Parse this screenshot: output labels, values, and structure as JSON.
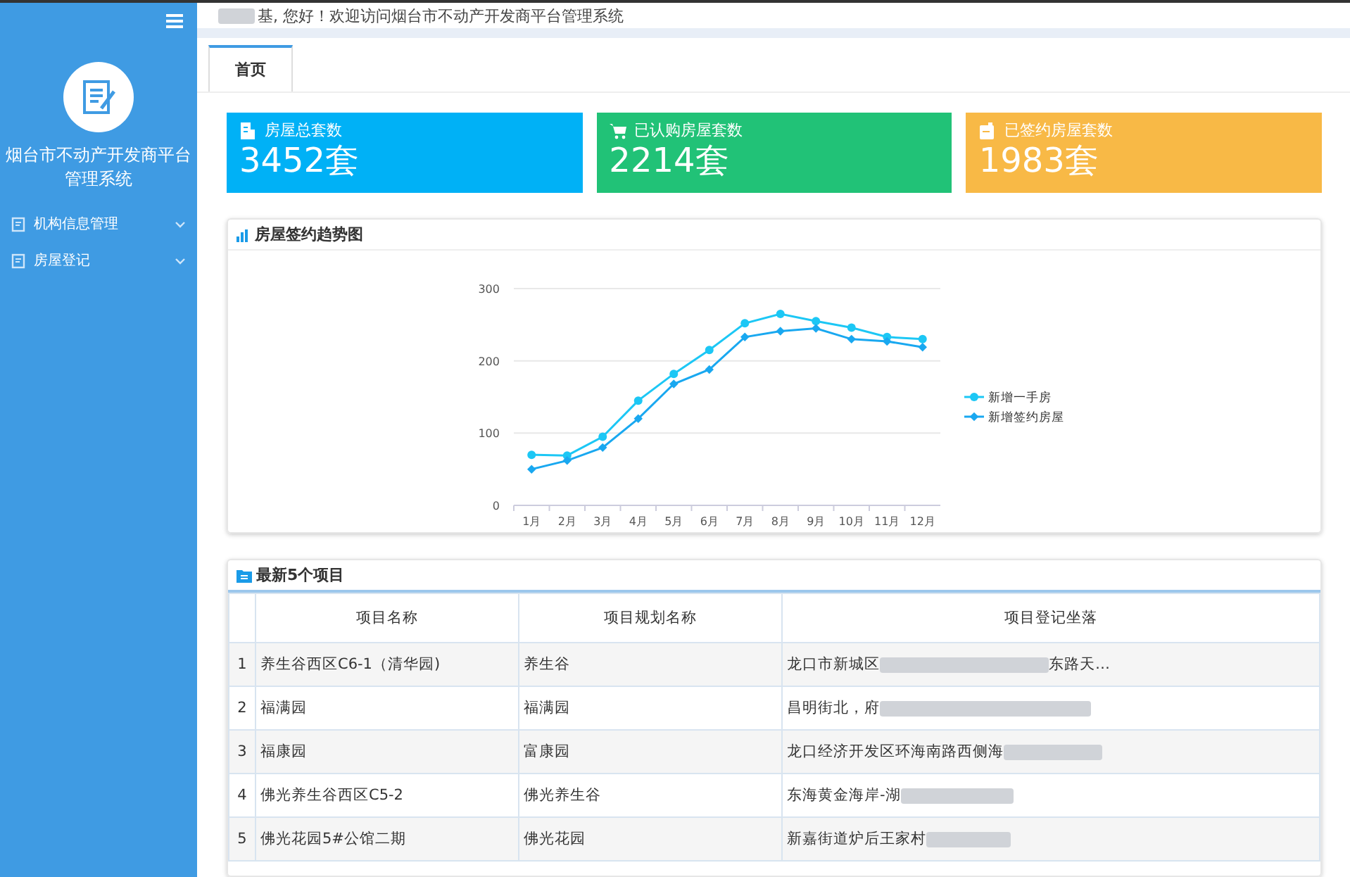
{
  "sidebar": {
    "title": "烟台市不动产开发商平台管理系统",
    "menu": [
      {
        "label": "机构信息管理",
        "expanded": false
      },
      {
        "label": "房屋登记",
        "expanded": false
      }
    ]
  },
  "header": {
    "greeting": "基, 您好！欢迎访问烟台市不动产开发商平台管理系统"
  },
  "tabs": [
    {
      "label": "首页",
      "selected": true
    }
  ],
  "stats": [
    {
      "kind": "building",
      "label": "房屋总套数",
      "value": "3452套",
      "color": "#00b1f6"
    },
    {
      "kind": "cart",
      "label": "已认购房屋套数",
      "value": "2214套",
      "color": "#21c277"
    },
    {
      "kind": "doc",
      "label": "已签约房屋套数",
      "value": "1983套",
      "color": "#f8b946"
    }
  ],
  "trend": {
    "title": "房屋签约趋势图",
    "chart_data": {
      "type": "line",
      "categories": [
        "1月",
        "2月",
        "3月",
        "4月",
        "5月",
        "6月",
        "7月",
        "8月",
        "9月",
        "10月",
        "11月",
        "12月"
      ],
      "ylim": [
        0,
        300
      ],
      "legend": "right",
      "yticks": [
        0,
        100,
        200,
        300
      ],
      "series": [
        {
          "name": "新增一手房",
          "color": "#1cc7f5",
          "marker": "circle",
          "values": [
            70,
            69,
            95,
            145,
            182,
            215,
            252,
            265,
            255,
            246,
            233,
            230
          ]
        },
        {
          "name": "新增签约房屋",
          "color": "#19a8f0",
          "marker": "diamond",
          "values": [
            50,
            62,
            80,
            120,
            168,
            188,
            233,
            241,
            245,
            230,
            227,
            219
          ]
        }
      ]
    }
  },
  "projects": {
    "title": "最新5个项目",
    "columns": [
      "项目名称",
      "项目规划名称",
      "项目登记坐落"
    ],
    "rows": [
      {
        "index": "1",
        "name": "养生谷西区C6-1（清华园)",
        "plan": "养生谷",
        "location": "龙口市新城区",
        "location_end": "东路天…"
      },
      {
        "index": "2",
        "name": "福满园",
        "plan": "福满园",
        "location": "昌明街北，府"
      },
      {
        "index": "3",
        "name": "福康园",
        "plan": "富康园",
        "location": "龙口经济开发区环海南路西侧海"
      },
      {
        "index": "4",
        "name": "佛光养生谷西区C5-2",
        "plan": "佛光养生谷",
        "location": "东海黄金海岸-湖"
      },
      {
        "index": "5",
        "name": "佛光花园5#公馆二期",
        "plan": "佛光花园",
        "location": "新嘉街道炉后王家村"
      }
    ]
  }
}
